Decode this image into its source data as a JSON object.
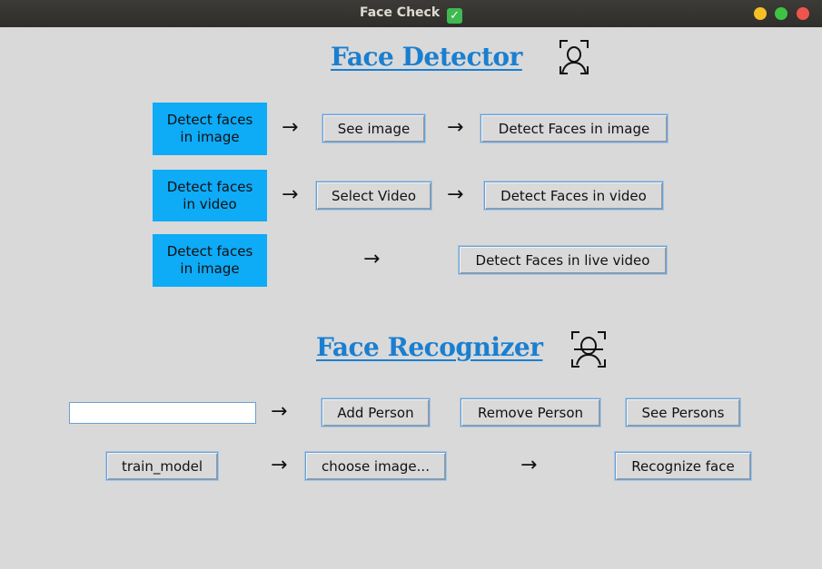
{
  "window": {
    "title": "Face Check",
    "title_emoji": "✓"
  },
  "detector": {
    "heading": "Face Detector",
    "rows": [
      {
        "label_line1": "Detect faces",
        "label_line2": "in image",
        "arrow1": "→",
        "select_button": "See image",
        "arrow2": "→",
        "action_button": "Detect Faces in image"
      },
      {
        "label_line1": "Detect faces",
        "label_line2": "in video",
        "arrow1": "→",
        "select_button": "Select Video",
        "arrow2": "→",
        "action_button": "Detect Faces in video"
      },
      {
        "label_line1": "Detect faces",
        "label_line2": "in image",
        "arrow1": "→",
        "action_button": "Detect Faces in live video"
      }
    ]
  },
  "recognizer": {
    "heading": "Face Recognizer",
    "name_input": {
      "value": "",
      "placeholder": ""
    },
    "arrow_add": "→",
    "add_button": "Add Person",
    "remove_button": "Remove Person",
    "see_button": "See Persons",
    "train_button": "train_model",
    "arrow_train": "→",
    "choose_button": "choose image...",
    "arrow_recognize": "→",
    "recognize_button": "Recognize face"
  },
  "colors": {
    "accent_blue": "#0eabf7",
    "heading_blue": "#1a7fd0",
    "window_bg": "#d9d9d9"
  },
  "icons": {
    "detector_icon": "face-scan-icon",
    "recognizer_icon": "face-recognition-icon"
  }
}
